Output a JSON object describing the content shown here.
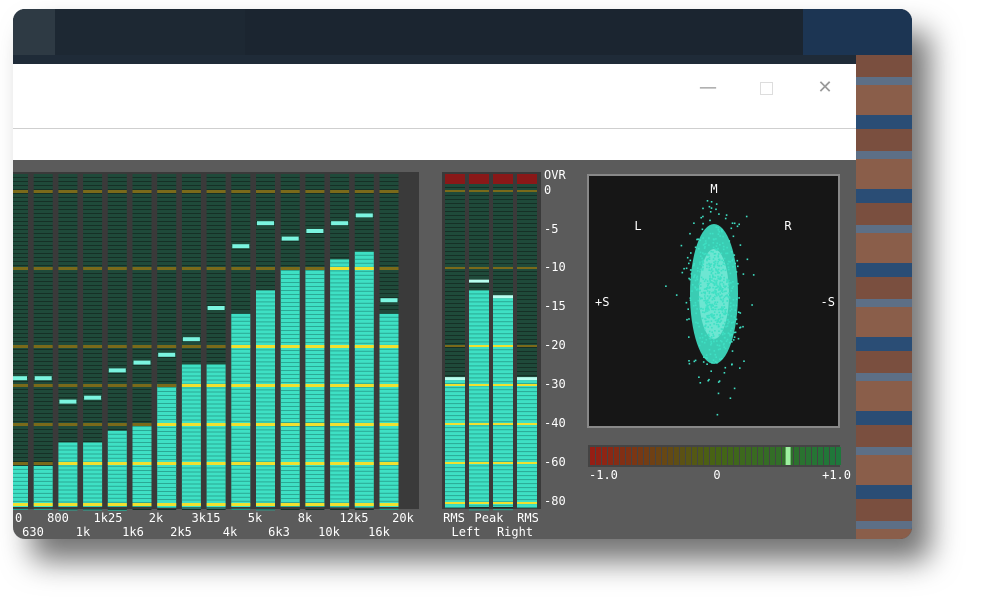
{
  "window": {
    "minimize_icon": "minimize-icon",
    "maximize_icon": "maximize-icon",
    "close_icon": "close-icon"
  },
  "spectrum": {
    "bands": [
      {
        "top": "630",
        "bottom": ""
      },
      {
        "top": "800",
        "bottom": "1k"
      },
      {
        "top": "1k25",
        "bottom": "1k6"
      },
      {
        "top": "2k",
        "bottom": "2k5"
      },
      {
        "top": "3k15",
        "bottom": "4k"
      },
      {
        "top": "5k",
        "bottom": "6k3"
      },
      {
        "top": "8k",
        "bottom": "10k"
      },
      {
        "top": "12k5",
        "bottom": "16k"
      },
      {
        "top": "20k",
        "bottom": ""
      }
    ],
    "x_labels_row1": [
      "0",
      "800",
      "1k25",
      "2k",
      "3k15",
      "5k",
      "8k",
      "12k5",
      "20k"
    ],
    "x_labels_row2": [
      "630",
      "1k",
      "1k6",
      "2k5",
      "4k",
      "6k3",
      "10k",
      "16k"
    ],
    "levels_db": [
      -62,
      -62,
      -50,
      -50,
      -44,
      -40,
      -30,
      -25,
      -25,
      -16,
      -13,
      -10,
      -10,
      -9,
      -8,
      -16
    ],
    "peaks_db": [
      -28,
      -28,
      -34,
      -33,
      -26,
      -24,
      -22,
      -19,
      -15,
      -7,
      -4,
      -6,
      -5,
      -4,
      -3,
      -14
    ]
  },
  "meters": {
    "scale": [
      "OVR",
      "0",
      "-5",
      "-10",
      "-15",
      "-20",
      "-30",
      "-40",
      "-60",
      "-80"
    ],
    "labels_top": [
      "RMS",
      "Peak",
      "RMS"
    ],
    "labels_bottom": [
      "Left",
      "Right"
    ],
    "levels_db": [
      -29,
      -13,
      -14,
      -29
    ],
    "peaks_db": [
      -29,
      -12,
      -14,
      -29
    ]
  },
  "goniometer": {
    "label_m": "M",
    "label_l": "L",
    "label_r": "R",
    "label_plus_s": "+S",
    "label_minus_s": "-S",
    "correlation_min": "-1.0",
    "correlation_mid": "0",
    "correlation_max": "+1.0",
    "correlation_value": 0.6
  },
  "colors": {
    "bar_fill": "#3ee0c4",
    "bar_unlit": "#1f4a3a",
    "peak": "#7bf5e0",
    "grid_yellow": "#f0e030",
    "ovr": "#8a1818",
    "scope_bg": "#161616"
  }
}
